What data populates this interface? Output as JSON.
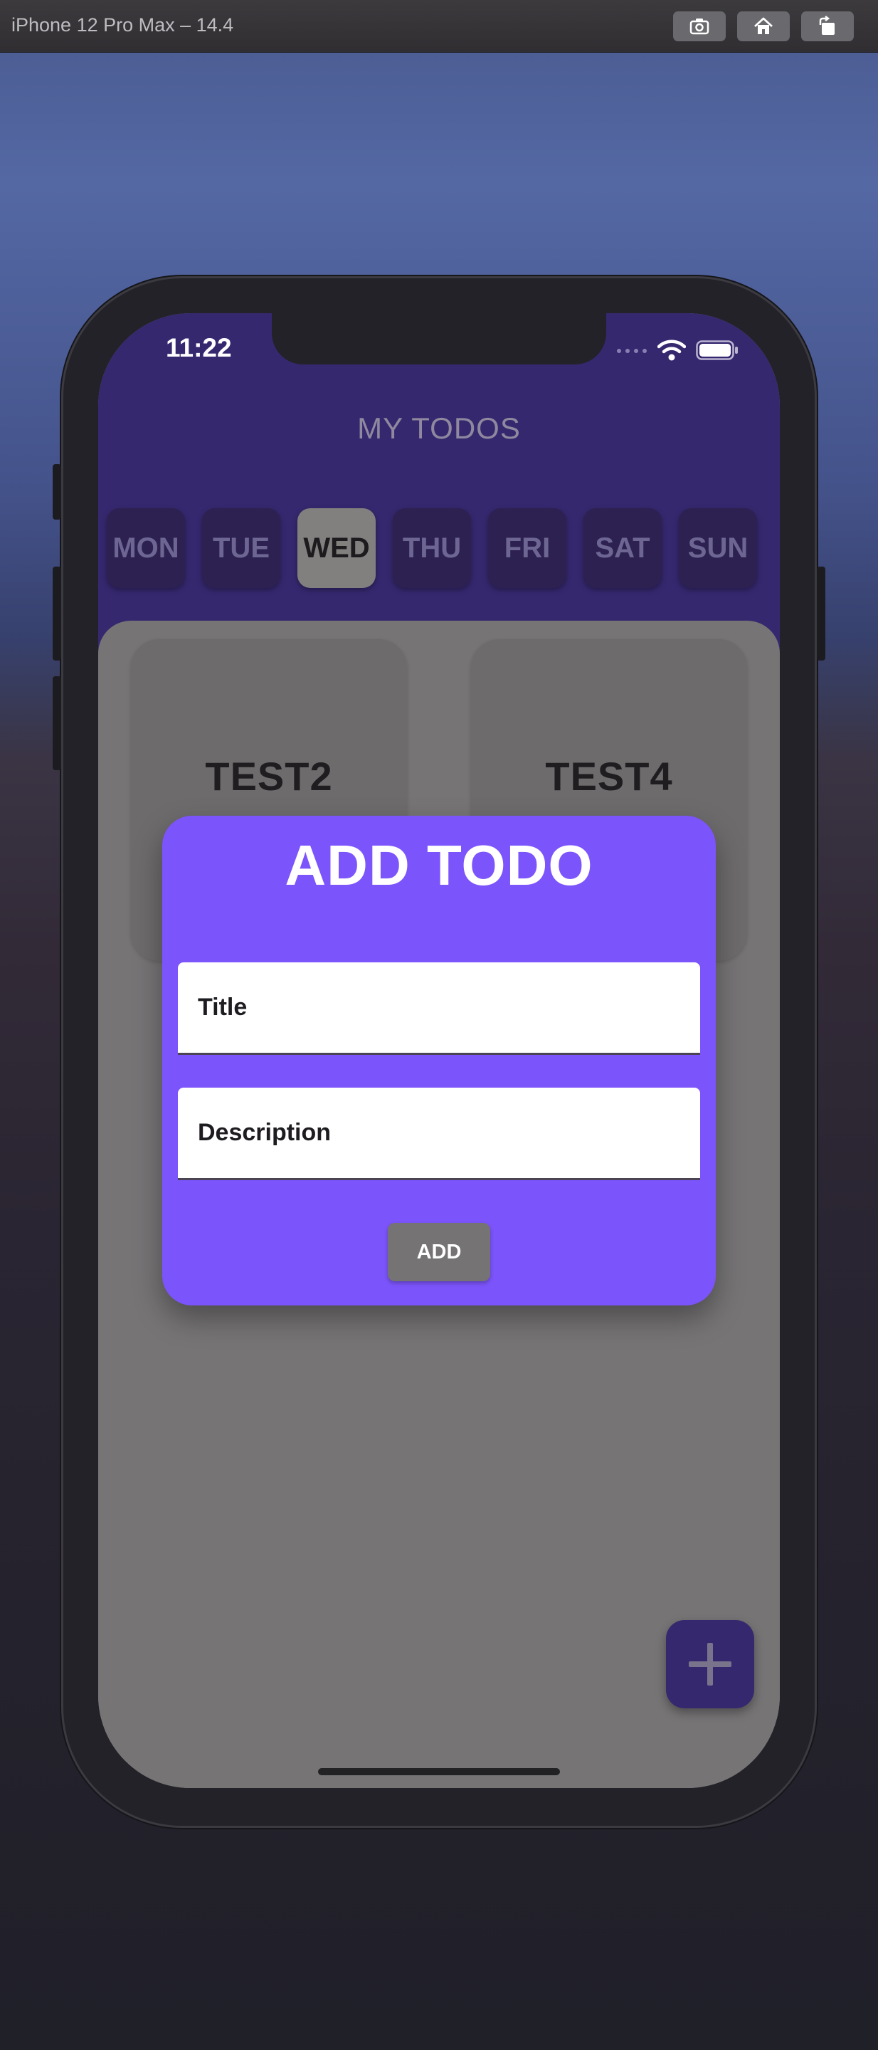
{
  "simulator": {
    "title": "iPhone 12 Pro Max – 14.4",
    "buttons": [
      "screenshot-icon",
      "home-icon",
      "rotate-icon"
    ]
  },
  "status_bar": {
    "time": "11:22",
    "icons": [
      "cellular-icon",
      "wifi-icon",
      "battery-icon"
    ]
  },
  "app": {
    "title": "MY TODOS",
    "days": [
      "MON",
      "TUE",
      "WED",
      "THU",
      "FRI",
      "SAT",
      "SUN"
    ],
    "selected_day": "WED",
    "todos": [
      {
        "title": "TEST2"
      },
      {
        "title": "TEST4"
      }
    ],
    "fab_icon": "plus-icon"
  },
  "dialog": {
    "title": "ADD TODO",
    "title_placeholder": "Title",
    "description_placeholder": "Description",
    "add_label": "ADD"
  },
  "colors": {
    "header": "#36286f",
    "dialog": "#7c54fb",
    "selected_day": "#827f7f",
    "overlay_content": "#767475"
  }
}
